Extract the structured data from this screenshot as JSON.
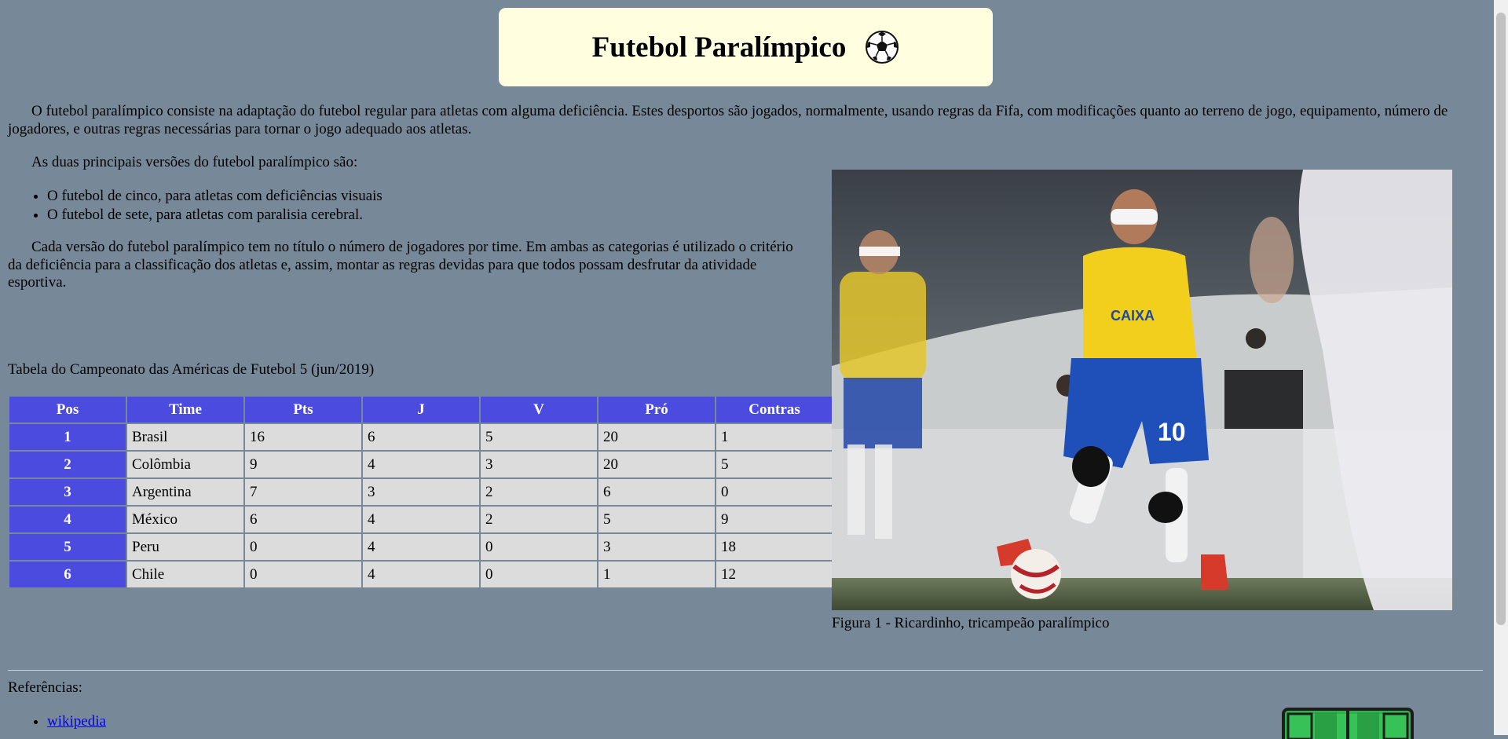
{
  "header": {
    "title": "Futebol Paralímpico"
  },
  "intro": "O futebol paralímpico consiste na adaptação do futebol regular para atletas com alguma deficiência. Estes desportos são jogados, normalmente, usando regras da Fifa, com modificações quanto ao terreno de jogo, equipamento, número de jogadores, e outras regras necessárias para tornar o jogo adequado aos atletas.",
  "versions": {
    "lead": "As duas principais versões do futebol paralímpico são:",
    "items": [
      "O futebol de cinco, para atletas com deficiências visuais",
      "O futebol de sete, para atletas com paralisia cerebral."
    ]
  },
  "extra": "Cada versão do futebol paralímpico tem no título o número de jogadores por time. Em ambas as categorias é utilizado o critério da deficiência para a classificação dos atletas e, assim, montar as regras devidas para que todos possam desfrutar da atividade esportiva.",
  "table": {
    "caption": "Tabela do Campeonato das Américas de Futebol 5 (jun/2019)",
    "headers": [
      "Pos",
      "Time",
      "Pts",
      "J",
      "V",
      "Pró",
      "Contras"
    ],
    "rows": [
      [
        "1",
        "Brasil",
        "16",
        "6",
        "5",
        "20",
        "1"
      ],
      [
        "2",
        "Colômbia",
        "9",
        "4",
        "3",
        "20",
        "5"
      ],
      [
        "3",
        "Argentina",
        "7",
        "3",
        "2",
        "6",
        "0"
      ],
      [
        "4",
        "México",
        "6",
        "4",
        "2",
        "5",
        "9"
      ],
      [
        "5",
        "Peru",
        "0",
        "4",
        "0",
        "3",
        "18"
      ],
      [
        "6",
        "Chile",
        "0",
        "4",
        "0",
        "1",
        "12"
      ]
    ]
  },
  "figure": {
    "caption": "Figura 1 - Ricardinho, tricampeão paralímpico",
    "jersey_number": "10",
    "sponsor": "CAIXA"
  },
  "references": {
    "title": "Referências:",
    "links": [
      "wikipedia"
    ]
  },
  "icons": {
    "ball": "soccer-ball-icon",
    "field": "soccer-field-icon"
  },
  "colors": {
    "background": "#778899",
    "header_bg": "#ffffe0",
    "table_header": "#4b4be0",
    "table_cell": "#dcdcdc",
    "link": "#0000ee"
  }
}
